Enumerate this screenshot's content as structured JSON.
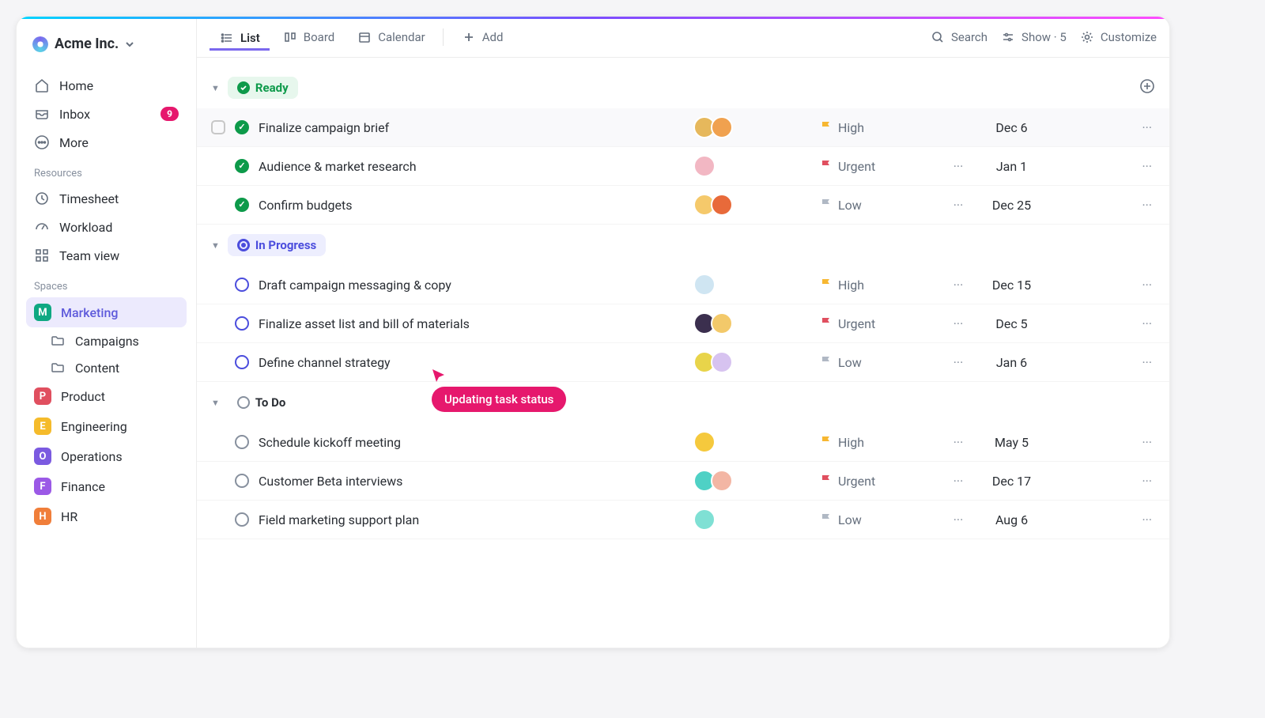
{
  "workspace": {
    "name": "Acme Inc."
  },
  "sidebar": {
    "nav": [
      {
        "label": "Home",
        "name": "home"
      },
      {
        "label": "Inbox",
        "name": "inbox",
        "badge": 9
      },
      {
        "label": "More",
        "name": "more"
      }
    ],
    "resources_label": "Resources",
    "resources": [
      {
        "label": "Timesheet",
        "name": "timesheet"
      },
      {
        "label": "Workload",
        "name": "workload"
      },
      {
        "label": "Team view",
        "name": "team-view"
      }
    ],
    "spaces_label": "Spaces",
    "spaces": [
      {
        "label": "Marketing",
        "letter": "M",
        "color": "#0fa882",
        "active": true,
        "folders": [
          "Campaigns",
          "Content"
        ]
      },
      {
        "label": "Product",
        "letter": "P",
        "color": "#e04f5f"
      },
      {
        "label": "Engineering",
        "letter": "E",
        "color": "#f5bb2b"
      },
      {
        "label": "Operations",
        "letter": "O",
        "color": "#7b5ae0"
      },
      {
        "label": "Finance",
        "letter": "F",
        "color": "#9b59e6"
      },
      {
        "label": "HR",
        "letter": "H",
        "color": "#f07e3a"
      }
    ]
  },
  "toolbar": {
    "views": [
      {
        "label": "List",
        "name": "list",
        "active": true
      },
      {
        "label": "Board",
        "name": "board"
      },
      {
        "label": "Calendar",
        "name": "calendar"
      }
    ],
    "add_label": "Add",
    "search_label": "Search",
    "show_label": "Show · 5",
    "customize_label": "Customize"
  },
  "groups": [
    {
      "name": "Ready",
      "style": "ready",
      "tasks": [
        {
          "title": "Finalize campaign brief",
          "assignees": [
            "#e6b85c",
            "#f0a14f"
          ],
          "priority": "High",
          "flag": "high",
          "date": "Dec 6",
          "hovered": true,
          "show_more": false
        },
        {
          "title": "Audience & market research",
          "assignees": [
            "#f2b7c3"
          ],
          "priority": "Urgent",
          "flag": "urgent",
          "date": "Jan 1",
          "show_more": true
        },
        {
          "title": "Confirm budgets",
          "assignees": [
            "#f5c96b",
            "#e86a3a"
          ],
          "priority": "Low",
          "flag": "low",
          "date": "Dec 25",
          "show_more": true
        }
      ]
    },
    {
      "name": "In Progress",
      "style": "progress",
      "tasks": [
        {
          "title": "Draft campaign messaging & copy",
          "assignees": [
            "#cfe5f2"
          ],
          "priority": "High",
          "flag": "high",
          "date": "Dec 15",
          "show_more": true
        },
        {
          "title": "Finalize asset list and bill of materials",
          "assignees": [
            "#3b2f4e",
            "#f3c96a"
          ],
          "priority": "Urgent",
          "flag": "urgent",
          "date": "Dec 5",
          "show_more": true
        },
        {
          "title": "Define channel strategy",
          "assignees": [
            "#e8d44a",
            "#d7c3f0"
          ],
          "priority": "Low",
          "flag": "low",
          "date": "Jan 6",
          "show_more": true
        }
      ]
    },
    {
      "name": "To Do",
      "style": "todo",
      "tasks": [
        {
          "title": "Schedule kickoff meeting",
          "assignees": [
            "#f5c93d"
          ],
          "priority": "High",
          "flag": "high",
          "date": "May 5",
          "show_more": true
        },
        {
          "title": "Customer Beta interviews",
          "assignees": [
            "#4fd1c5",
            "#f3b6a4"
          ],
          "priority": "Urgent",
          "flag": "urgent",
          "date": "Dec 17",
          "show_more": true
        },
        {
          "title": "Field marketing support plan",
          "assignees": [
            "#7fe0d4"
          ],
          "priority": "Low",
          "flag": "low",
          "date": "Aug 6",
          "show_more": true
        }
      ]
    }
  ],
  "cursor_tooltip": "Updating task status"
}
